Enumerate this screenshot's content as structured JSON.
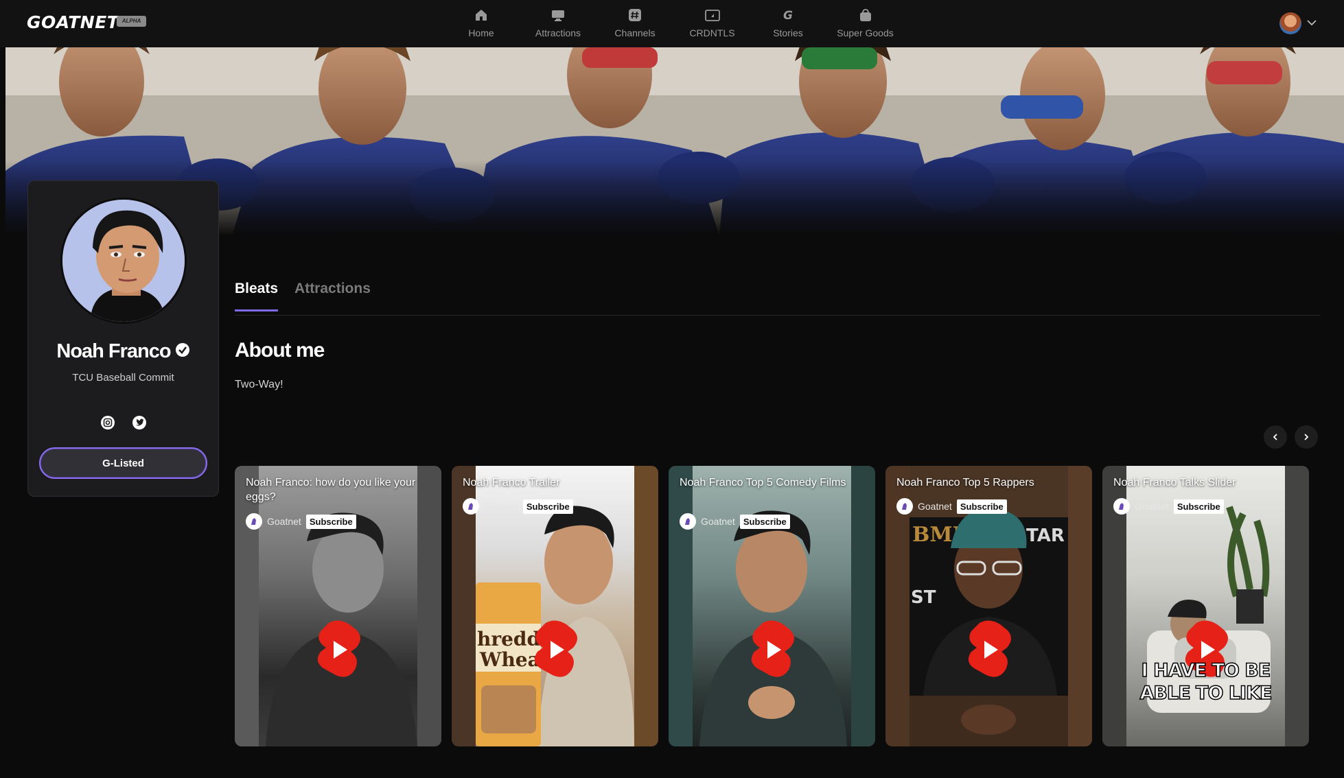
{
  "brand": {
    "logo": "GOATNET",
    "badge": "ALPHA"
  },
  "nav": [
    {
      "label": "Home",
      "icon": "home-icon"
    },
    {
      "label": "Attractions",
      "icon": "monitor-icon"
    },
    {
      "label": "Channels",
      "icon": "hashtag-icon"
    },
    {
      "label": "CRDNTLS",
      "icon": "card-icon"
    },
    {
      "label": "Stories",
      "icon": "g-icon"
    },
    {
      "label": "Super Goods",
      "icon": "bag-icon"
    }
  ],
  "profile": {
    "name": "Noah Franco",
    "subtitle": "TCU Baseball Commit",
    "button": "G-Listed",
    "socials": [
      "instagram-icon",
      "twitter-icon"
    ]
  },
  "tabs": [
    {
      "label": "Bleats",
      "active": true
    },
    {
      "label": "Attractions",
      "active": false
    }
  ],
  "about": {
    "heading": "About me",
    "text": "Two-Way!"
  },
  "videos": [
    {
      "title": "Noah Franco: how do you like your eggs?",
      "channel": "Goatnet",
      "subscribe": "Subscribe",
      "caption": ""
    },
    {
      "title": "Noah Franco Trailer",
      "channel": "Goatnet",
      "subscribe": "Subscribe",
      "caption": ""
    },
    {
      "title": "Noah Franco Top 5 Comedy Films",
      "channel": "Goatnet",
      "subscribe": "Subscribe",
      "caption": ""
    },
    {
      "title": "Noah Franco Top 5 Rappers",
      "channel": "Goatnet",
      "subscribe": "Subscribe",
      "caption": ""
    },
    {
      "title": "Noah Franco Talks Slider",
      "channel": "Goatnet",
      "subscribe": "Subscribe",
      "caption": "I HAVE TO BE ABLE TO LIKE"
    }
  ],
  "colors": {
    "accent": "#7f6ae6",
    "play": "#e62117",
    "background": "#0b0b0b"
  }
}
